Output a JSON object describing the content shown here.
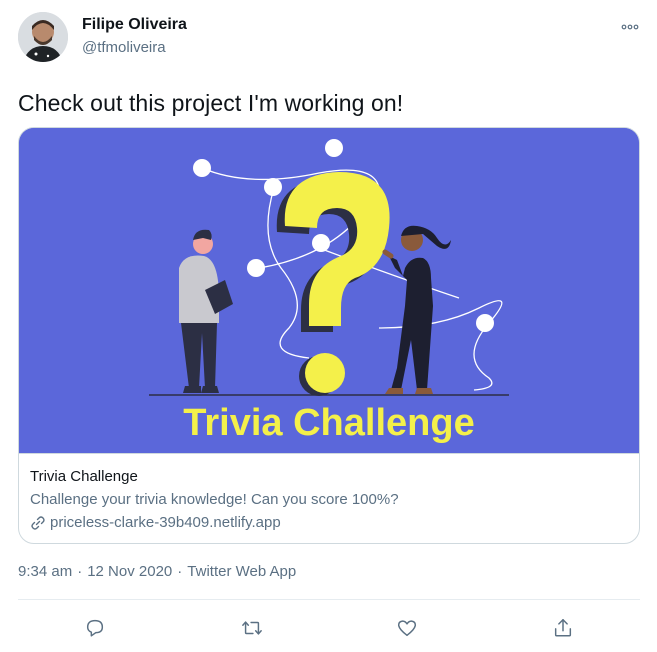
{
  "author": {
    "name": "Filipe Oliveira",
    "handle": "@tfmoliveira",
    "avatar_icon": "avatar-photo"
  },
  "tweet": {
    "text": "Check out this project I'm working on!"
  },
  "card": {
    "image_text": "Trivia Challenge",
    "title": "Trivia Challenge",
    "description": "Challenge your trivia knowledge! Can you score 100%?",
    "url": "priceless-clarke-39b409.netlify.app",
    "image_background": "#5b67da",
    "accent": "#f4f04a"
  },
  "meta": {
    "time": "9:34 am",
    "date": "12 Nov 2020",
    "separator": "·",
    "source": "Twitter Web App"
  },
  "actions": [
    {
      "icon": "reply-icon"
    },
    {
      "icon": "retweet-icon"
    },
    {
      "icon": "like-icon"
    },
    {
      "icon": "share-icon"
    }
  ],
  "colors": {
    "text": "#0f1419",
    "secondary": "#5b7083",
    "border": "#cfd9de"
  }
}
